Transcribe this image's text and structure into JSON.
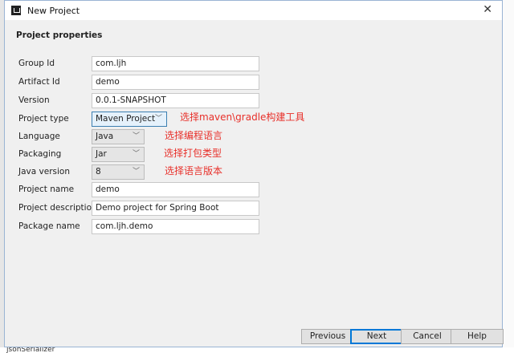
{
  "window": {
    "title": "New Project",
    "close_icon": "close-icon"
  },
  "section_title": "Project properties",
  "fields": [
    {
      "label": "Group Id",
      "value": "com.ljh"
    },
    {
      "label": "Artifact Id",
      "value": "demo"
    },
    {
      "label": "Version",
      "value": "0.0.1-SNAPSHOT"
    },
    {
      "label": "Project type",
      "value": "Maven Project",
      "annotation": "选择maven\\gradle构建工具"
    },
    {
      "label": "Language",
      "value": "Java",
      "annotation": "选择编程语言"
    },
    {
      "label": "Packaging",
      "value": "Jar",
      "annotation": "选择打包类型"
    },
    {
      "label": "Java version",
      "value": "8",
      "annotation": "选择语言版本"
    },
    {
      "label": "Project name",
      "value": "demo"
    },
    {
      "label": "Project description",
      "value": "Demo project for Spring Boot"
    },
    {
      "label": "Package name",
      "value": "com.ljh.demo"
    }
  ],
  "buttons": {
    "previous": "Previous",
    "next": "Next",
    "cancel": "Cancel",
    "help": "Help"
  },
  "background": {
    "bottom_text": "jsonSerializer"
  },
  "colors": {
    "annotation": "#e8302a",
    "focus": "#0078d7"
  }
}
